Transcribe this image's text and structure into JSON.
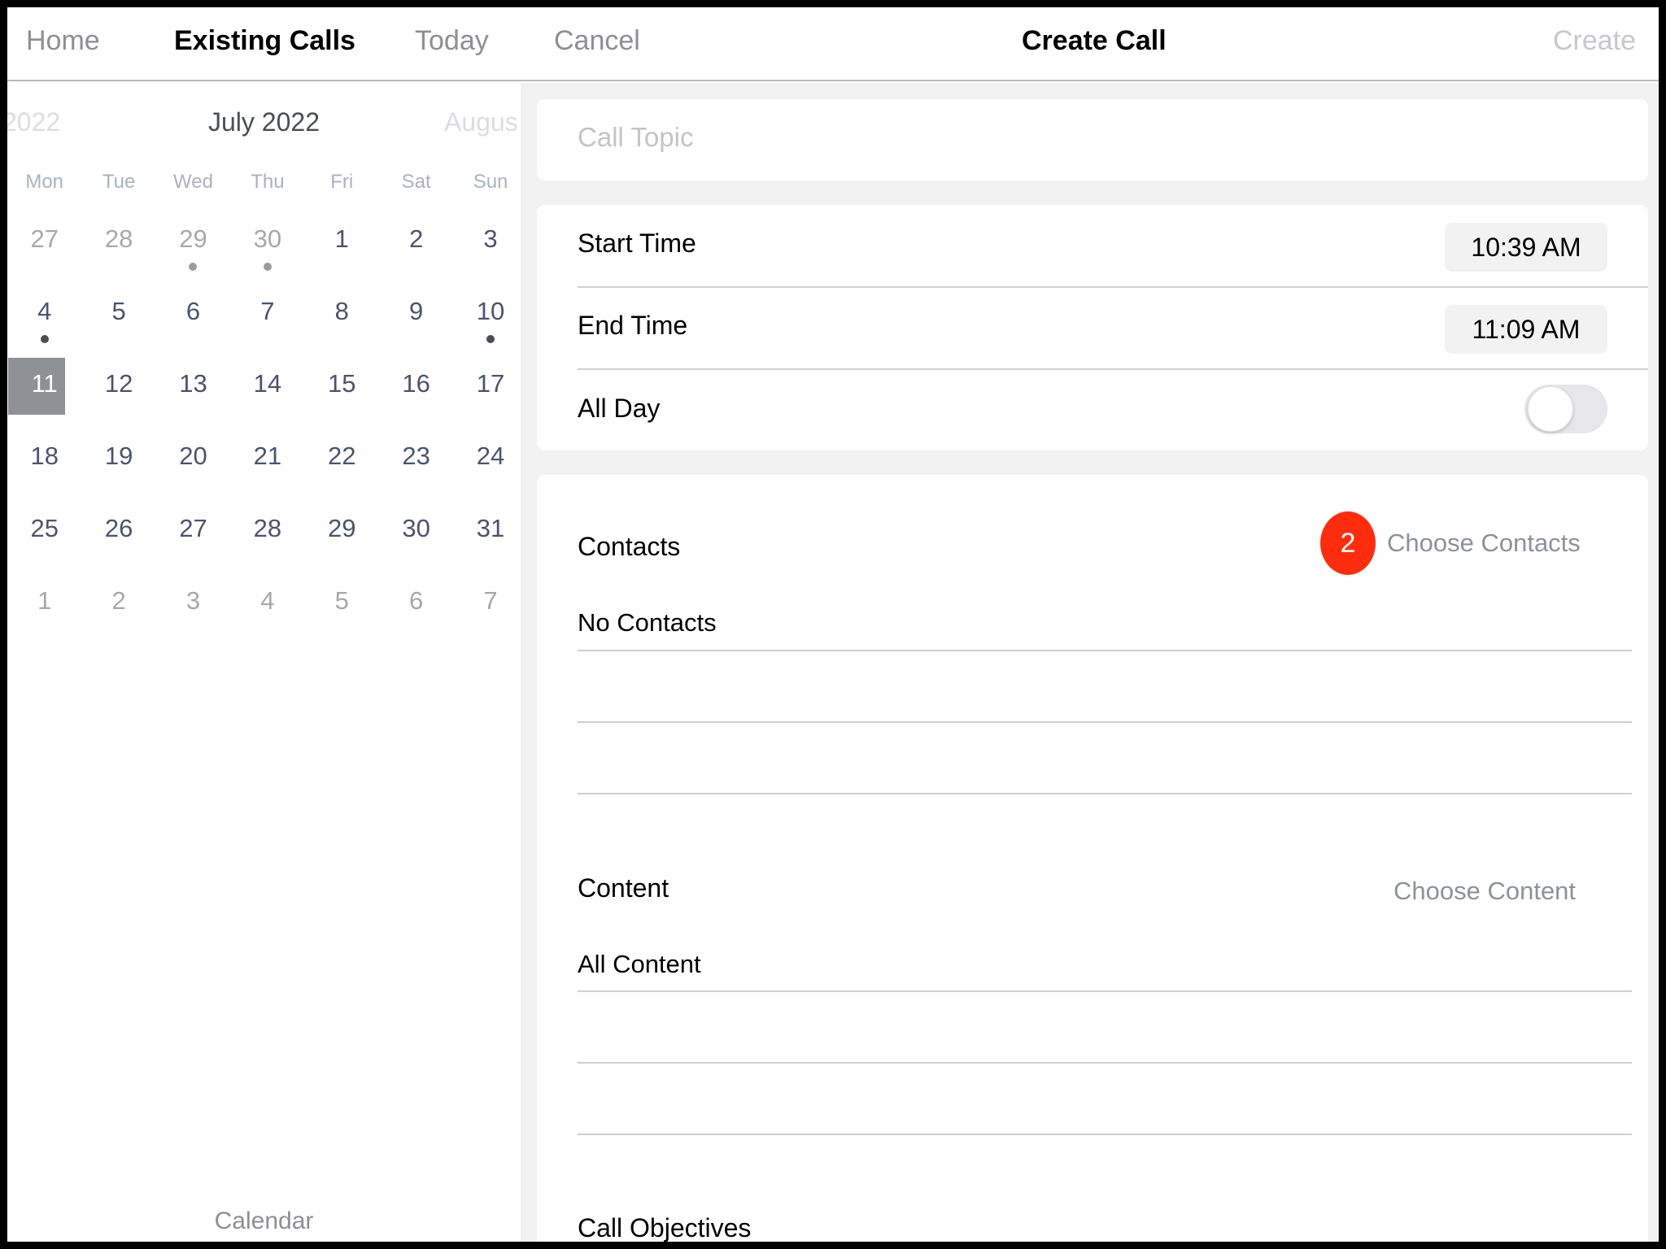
{
  "navbar": {
    "home": "Home",
    "existing_calls": "Existing Calls",
    "today": "Today",
    "cancel": "Cancel",
    "title": "Create Call",
    "create": "Create"
  },
  "calendar": {
    "prev_month": "2022",
    "current_month": "July 2022",
    "next_month": "Augus",
    "weekdays": [
      "Mon",
      "Tue",
      "Wed",
      "Thu",
      "Fri",
      "Sat",
      "Sun"
    ],
    "weeks": [
      [
        {
          "d": "27",
          "muted": true
        },
        {
          "d": "28",
          "muted": true
        },
        {
          "d": "29",
          "muted": true,
          "dot": "light"
        },
        {
          "d": "30",
          "muted": true,
          "dot": "light"
        },
        {
          "d": "1"
        },
        {
          "d": "2"
        },
        {
          "d": "3"
        }
      ],
      [
        {
          "d": "4",
          "dot": "dark"
        },
        {
          "d": "5"
        },
        {
          "d": "6"
        },
        {
          "d": "7"
        },
        {
          "d": "8"
        },
        {
          "d": "9"
        },
        {
          "d": "10",
          "dot": "dark"
        }
      ],
      [
        {
          "d": "11",
          "selected": true
        },
        {
          "d": "12"
        },
        {
          "d": "13"
        },
        {
          "d": "14"
        },
        {
          "d": "15"
        },
        {
          "d": "16"
        },
        {
          "d": "17"
        }
      ],
      [
        {
          "d": "18"
        },
        {
          "d": "19"
        },
        {
          "d": "20"
        },
        {
          "d": "21"
        },
        {
          "d": "22"
        },
        {
          "d": "23"
        },
        {
          "d": "24"
        }
      ],
      [
        {
          "d": "25"
        },
        {
          "d": "26"
        },
        {
          "d": "27"
        },
        {
          "d": "28"
        },
        {
          "d": "29"
        },
        {
          "d": "30"
        },
        {
          "d": "31"
        }
      ],
      [
        {
          "d": "1",
          "muted": true
        },
        {
          "d": "2",
          "muted": true
        },
        {
          "d": "3",
          "muted": true
        },
        {
          "d": "4",
          "muted": true
        },
        {
          "d": "5",
          "muted": true
        },
        {
          "d": "6",
          "muted": true
        },
        {
          "d": "7",
          "muted": true
        }
      ]
    ],
    "selected_date": "11",
    "footer_tab": "Calendar"
  },
  "form": {
    "call_topic": {
      "placeholder": "Call Topic",
      "value": ""
    },
    "start_time": {
      "label": "Start Time",
      "value": "10:39 AM"
    },
    "end_time": {
      "label": "End Time",
      "value": "11:09 AM"
    },
    "all_day": {
      "label": "All Day",
      "on": false
    },
    "contacts": {
      "title": "Contacts",
      "badge_count": "2",
      "choose_label": "Choose Contacts",
      "value": "No Contacts"
    },
    "content": {
      "title": "Content",
      "choose_label": "Choose Content",
      "value": "All Content"
    },
    "call_objectives": {
      "title": "Call Objectives"
    }
  },
  "colors": {
    "badge": "#ff2d0e",
    "selected_day": "#8e9196",
    "accent_text": "#8e9196"
  }
}
